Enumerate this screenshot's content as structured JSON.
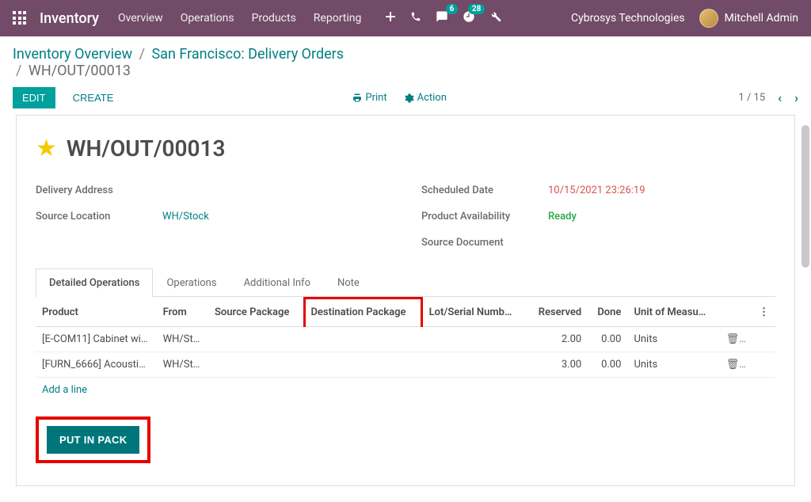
{
  "navbar": {
    "brand": "Inventory",
    "items": [
      "Overview",
      "Operations",
      "Products",
      "Reporting"
    ],
    "badge_chat": "6",
    "badge_clock": "28",
    "company": "Cybrosys Technologies",
    "user": "Mitchell Admin"
  },
  "breadcrumb": {
    "root": "Inventory Overview",
    "mid": "San Francisco: Delivery Orders",
    "current": "WH/OUT/00013"
  },
  "buttons": {
    "edit": "EDIT",
    "create": "CREATE",
    "print": "Print",
    "action": "Action",
    "put_in_pack": "PUT IN PACK"
  },
  "pager": {
    "pos": "1 / 15"
  },
  "doc": {
    "title": "WH/OUT/00013"
  },
  "fields": {
    "delivery_address_lbl": "Delivery Address",
    "source_location_lbl": "Source Location",
    "source_location_val": "WH/Stock",
    "scheduled_date_lbl": "Scheduled Date",
    "scheduled_date_val": "10/15/2021 23:26:19",
    "availability_lbl": "Product Availability",
    "availability_val": "Ready",
    "source_doc_lbl": "Source Document"
  },
  "tabs": [
    "Detailed Operations",
    "Operations",
    "Additional Info",
    "Note"
  ],
  "columns": {
    "product": "Product",
    "from": "From",
    "source_pkg": "Source Package",
    "dest_pkg": "Destination Package",
    "lot": "Lot/Serial Numb…",
    "reserved": "Reserved",
    "done": "Done",
    "uom": "Unit of Measu…"
  },
  "rows": [
    {
      "product": "[E-COM11] Cabinet wi…",
      "from": "WH/Sto…",
      "reserved": "2.00",
      "done": "0.00",
      "uom": "Units"
    },
    {
      "product": "[FURN_6666] Acousti…",
      "from": "WH/Sto…",
      "reserved": "3.00",
      "done": "0.00",
      "uom": "Units"
    }
  ],
  "add_line": "Add a line"
}
